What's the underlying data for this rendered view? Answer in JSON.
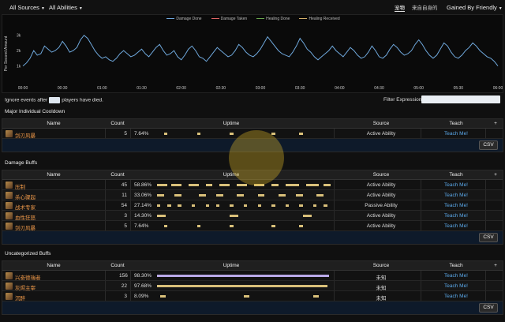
{
  "topbar": {
    "sources": "All Sources",
    "abilities": "All Abilities",
    "tab1": "宠物",
    "tab2": "来自自身的",
    "mode": "Gained By Friendly"
  },
  "chart_data": {
    "type": "line",
    "legend": [
      "Damage Done",
      "Damage Taken",
      "Healing Done",
      "Healing Received"
    ],
    "legend_colors": [
      "#6fa8dc",
      "#e06666",
      "#6aa84f",
      "#d4b06a"
    ],
    "ylabel": "Per Second Amount",
    "yticks": [
      "3k",
      "2k",
      "1k"
    ],
    "xticks": [
      "00:00",
      "00:30",
      "01:00",
      "01:30",
      "02:00",
      "02:30",
      "03:00",
      "03:30",
      "04:00",
      "04:30",
      "05:00",
      "05:30",
      "06:00"
    ],
    "series": [
      {
        "values": [
          1.0,
          1.2,
          1.5,
          2.0,
          1.7,
          1.8,
          2.3,
          2.1,
          1.9,
          2.0,
          2.2,
          2.6,
          2.3,
          1.9,
          2.0,
          2.2,
          2.7,
          3.0,
          2.8,
          2.4,
          2.0,
          1.7,
          1.5,
          1.6,
          1.4,
          1.3,
          1.5,
          1.8,
          2.0,
          1.8,
          1.6,
          1.7,
          1.9,
          2.1,
          1.8,
          1.6,
          1.9,
          2.2,
          2.4,
          2.0,
          1.7,
          1.8,
          2.0,
          1.6,
          1.4,
          1.7,
          2.1,
          2.3,
          2.0,
          1.6,
          1.5,
          1.3,
          1.6,
          1.9,
          2.2,
          2.0,
          1.8,
          1.6,
          1.7,
          2.0,
          2.4,
          2.2,
          1.9,
          1.7,
          1.6,
          1.8,
          2.1,
          2.5,
          2.9,
          2.6,
          2.3,
          2.0,
          1.8,
          1.7,
          1.6,
          1.9,
          2.3,
          2.8,
          2.5,
          2.1,
          1.9,
          1.6,
          1.4,
          1.6,
          1.8,
          2.0,
          2.3,
          2.0,
          1.8,
          1.6,
          1.9,
          2.2,
          2.0,
          1.7,
          1.5,
          1.6,
          1.9,
          2.3,
          2.0,
          1.6,
          1.5,
          1.7,
          2.1,
          2.4,
          2.2,
          1.9,
          1.7,
          1.8,
          2.0,
          2.4,
          2.7,
          2.4,
          2.0,
          1.7,
          1.5,
          1.7,
          2.1,
          2.5,
          2.3,
          1.9,
          1.6,
          1.5,
          1.7,
          2.0,
          2.2,
          2.5,
          2.3,
          2.0,
          1.8,
          1.6,
          1.5,
          1.3,
          1.0
        ]
      }
    ]
  },
  "ignore": {
    "pre": "Ignore events after",
    "post": "players have died."
  },
  "filter_label": "Filter Expression:",
  "headers": {
    "name": "Name",
    "count": "Count",
    "uptime": "Uptime",
    "source": "Source",
    "teach": "Teach",
    "plus": "+"
  },
  "csv": "CSV",
  "sections": [
    {
      "title": "Major Individual Cooldown",
      "rows": [
        {
          "name": "剑刃风暴",
          "count": "5",
          "pct": "7.64%",
          "source": "Active Ability",
          "teach": "Teach Me!",
          "segs": [
            [
              0.04,
              0.06
            ],
            [
              0.23,
              0.25
            ],
            [
              0.42,
              0.44
            ],
            [
              0.66,
              0.68
            ],
            [
              0.82,
              0.84
            ]
          ],
          "purple": false
        }
      ]
    },
    {
      "title": "Damage Buffs",
      "rows": [
        {
          "name": "压制",
          "count": "45",
          "pct": "58.86%",
          "source": "Active Ability",
          "teach": "Teach Me!",
          "segs": [
            [
              0.0,
              0.06
            ],
            [
              0.08,
              0.14
            ],
            [
              0.18,
              0.24
            ],
            [
              0.28,
              0.32
            ],
            [
              0.36,
              0.42
            ],
            [
              0.46,
              0.52
            ],
            [
              0.56,
              0.62
            ],
            [
              0.66,
              0.7
            ],
            [
              0.74,
              0.82
            ],
            [
              0.86,
              0.93
            ],
            [
              0.96,
              1.0
            ]
          ],
          "purple": false
        },
        {
          "name": "杀心骤起",
          "count": "11",
          "pct": "33.06%",
          "source": "Active Ability",
          "teach": "Teach Me!",
          "segs": [
            [
              0.0,
              0.04
            ],
            [
              0.1,
              0.14
            ],
            [
              0.24,
              0.28
            ],
            [
              0.34,
              0.38
            ],
            [
              0.46,
              0.5
            ],
            [
              0.58,
              0.62
            ],
            [
              0.7,
              0.74
            ],
            [
              0.8,
              0.84
            ],
            [
              0.92,
              0.96
            ]
          ],
          "purple": false
        },
        {
          "name": "战术专家",
          "count": "54",
          "pct": "27.14%",
          "source": "Passive Ability",
          "teach": "Teach Me!",
          "segs": [
            [
              0.0,
              0.02
            ],
            [
              0.06,
              0.08
            ],
            [
              0.12,
              0.14
            ],
            [
              0.2,
              0.22
            ],
            [
              0.28,
              0.3
            ],
            [
              0.34,
              0.36
            ],
            [
              0.42,
              0.44
            ],
            [
              0.5,
              0.52
            ],
            [
              0.58,
              0.6
            ],
            [
              0.66,
              0.68
            ],
            [
              0.74,
              0.76
            ],
            [
              0.82,
              0.84
            ],
            [
              0.9,
              0.92
            ],
            [
              0.96,
              0.98
            ]
          ],
          "purple": false
        },
        {
          "name": "血性狂怒",
          "count": "3",
          "pct": "14.30%",
          "source": "Active Ability",
          "teach": "Teach Me!",
          "segs": [
            [
              0.0,
              0.05
            ],
            [
              0.42,
              0.47
            ],
            [
              0.84,
              0.89
            ]
          ],
          "purple": false
        },
        {
          "name": "剑刃风暴",
          "count": "5",
          "pct": "7.64%",
          "source": "Active Ability",
          "teach": "Teach Me!",
          "segs": [
            [
              0.04,
              0.06
            ],
            [
              0.23,
              0.25
            ],
            [
              0.42,
              0.44
            ],
            [
              0.66,
              0.68
            ],
            [
              0.82,
              0.84
            ]
          ],
          "purple": false
        }
      ]
    },
    {
      "title": "Uncategorized Buffs",
      "rows": [
        {
          "name": "兴奋德瑞者",
          "count": "156",
          "pct": "98.30%",
          "source": "未知",
          "teach": "Teach Me!",
          "segs": [
            [
              0.0,
              0.99
            ]
          ],
          "purple": true
        },
        {
          "name": "灰烬主宰",
          "count": "22",
          "pct": "97.68%",
          "source": "未知",
          "teach": "Teach Me!",
          "segs": [
            [
              0.0,
              0.98
            ]
          ],
          "purple": false
        },
        {
          "name": "沉醉",
          "count": "3",
          "pct": "8.09%",
          "source": "未知",
          "teach": "Teach Me!",
          "segs": [
            [
              0.02,
              0.05
            ],
            [
              0.5,
              0.53
            ],
            [
              0.9,
              0.93
            ]
          ],
          "purple": false
        }
      ]
    }
  ]
}
